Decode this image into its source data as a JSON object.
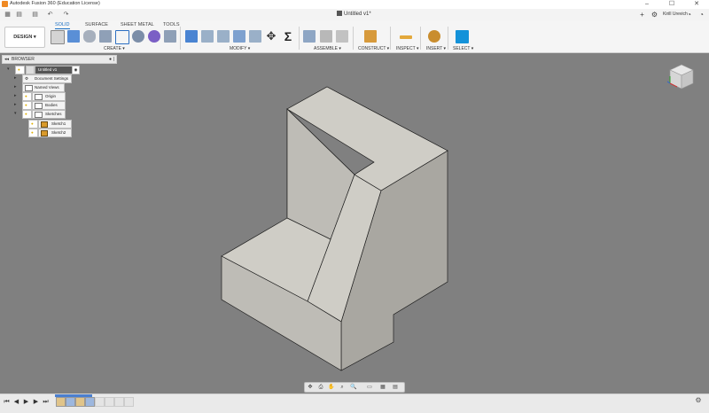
{
  "app": {
    "window_title": "Autodesk Fusion 360 (Education License)",
    "document_tab": "Untitled v1*",
    "user_name": "Kirill Urevich",
    "win_controls": {
      "minimize": "–",
      "maximize": "☐",
      "close": "✕"
    }
  },
  "quick_access": {
    "grid_icon": "▦",
    "save_icon": "▤",
    "undo_icon": "↶",
    "redo_icon": "↷",
    "plus_icon": "+",
    "extensions_icon": "⚙",
    "notifications_icon": "◔"
  },
  "workspace": {
    "label": "DESIGN ▾"
  },
  "ribbon_tabs": [
    "SOLID",
    "SURFACE",
    "SHEET METAL",
    "TOOLS"
  ],
  "ribbon_groups": {
    "create": "CREATE ▾",
    "modify": "MODIFY ▾",
    "assemble": "ASSEMBLE ▾",
    "construct": "CONSTRUCT ▾",
    "inspect": "INSPECT ▾",
    "insert": "INSERT ▾",
    "select": "SELECT ▾"
  },
  "modify_sigma": "Σ",
  "move_glyph": "✥",
  "browser": {
    "title": "BROWSER",
    "collapse_glyph": "◂◂",
    "options_glyph": "●",
    "pin_glyph": "|",
    "root": "Untitled v1",
    "items": [
      {
        "label": "Document Settings"
      },
      {
        "label": "Named Views"
      },
      {
        "label": "Origin"
      },
      {
        "label": "Bodies"
      },
      {
        "label": "Sketches"
      }
    ],
    "sketches": [
      {
        "label": "Sketch1"
      },
      {
        "label": "Sketch2"
      }
    ]
  },
  "glyphs": {
    "arrow_right": "▸",
    "arrow_down": "▾",
    "bulb": "💡",
    "target": "◉"
  },
  "navbar_glyphs": [
    "✥",
    "⎙",
    "✋",
    "⌕",
    "🔍",
    "▭",
    "▦",
    "▤"
  ],
  "timeline": {
    "controls": [
      "⏮",
      "◀",
      "▶",
      "▶",
      "⏭"
    ],
    "gear": "⚙"
  },
  "colors": {
    "viewport": "#808080",
    "face_top": "#cfcdc6",
    "face_left": "#bebcb6",
    "face_right": "#a9a7a1",
    "edge": "#1e1e1e",
    "accent": "#1a6fc4"
  }
}
